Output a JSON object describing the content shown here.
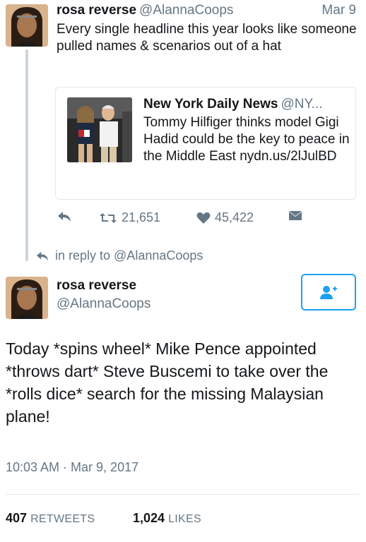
{
  "tweet1": {
    "name": "rosa reverse",
    "handle": "@AlannaCoops",
    "date": "Mar 9",
    "text": "Every single headline this year looks like someone pulled names & scenarios out of a hat",
    "quote": {
      "name": "New York Daily News",
      "handle": "@NY...",
      "text": "Tommy Hilfiger thinks model Gigi Hadid could be the key to peace in the Middle East nydn.us/2lJulBD"
    },
    "actions": {
      "retweets": "21,651",
      "likes": "45,422"
    }
  },
  "in_reply_to": "in reply to @AlannaCoops",
  "tweet2": {
    "name": "rosa reverse",
    "handle": "@AlannaCoops",
    "text": "Today *spins wheel* Mike Pence appointed *throws dart* Steve Buscemi to take over the *rolls dice* search for the missing Malaysian plane!",
    "timestamp": "10:03 AM · Mar 9, 2017",
    "retweets_count": "407",
    "retweets_label": "RETWEETS",
    "likes_count": "1,024",
    "likes_label": "LIKES"
  },
  "icons": {
    "reply": "reply-icon",
    "retweet": "retweet-icon",
    "like": "heart-icon",
    "dm": "envelope-icon",
    "follow": "add-user-icon"
  },
  "colors": {
    "accent": "#1da1f2",
    "secondary_text": "#657786",
    "border": "#e1e8ed"
  }
}
